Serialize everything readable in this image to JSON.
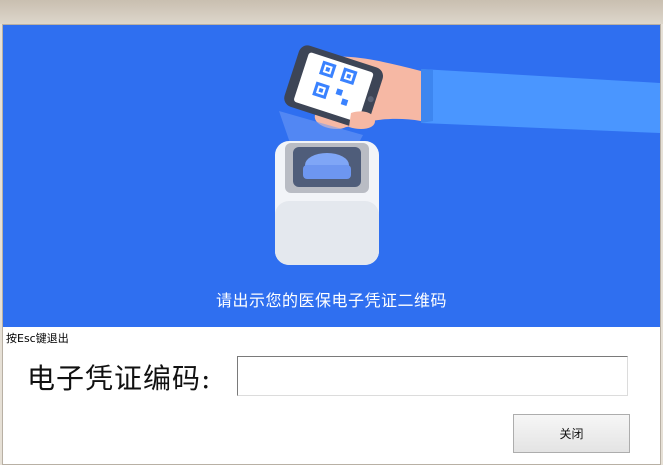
{
  "banner": {
    "prompt_text": "请出示您的医保电子凭证二维码",
    "illustration": "phone-scanning-qr-code-on-reader",
    "background_color": "#2f6ff0"
  },
  "hint": {
    "esc_text": "按Esc键退出"
  },
  "form": {
    "code_label": "电子凭证编码:",
    "code_value": "",
    "code_placeholder": ""
  },
  "actions": {
    "close_label": "关闭"
  }
}
